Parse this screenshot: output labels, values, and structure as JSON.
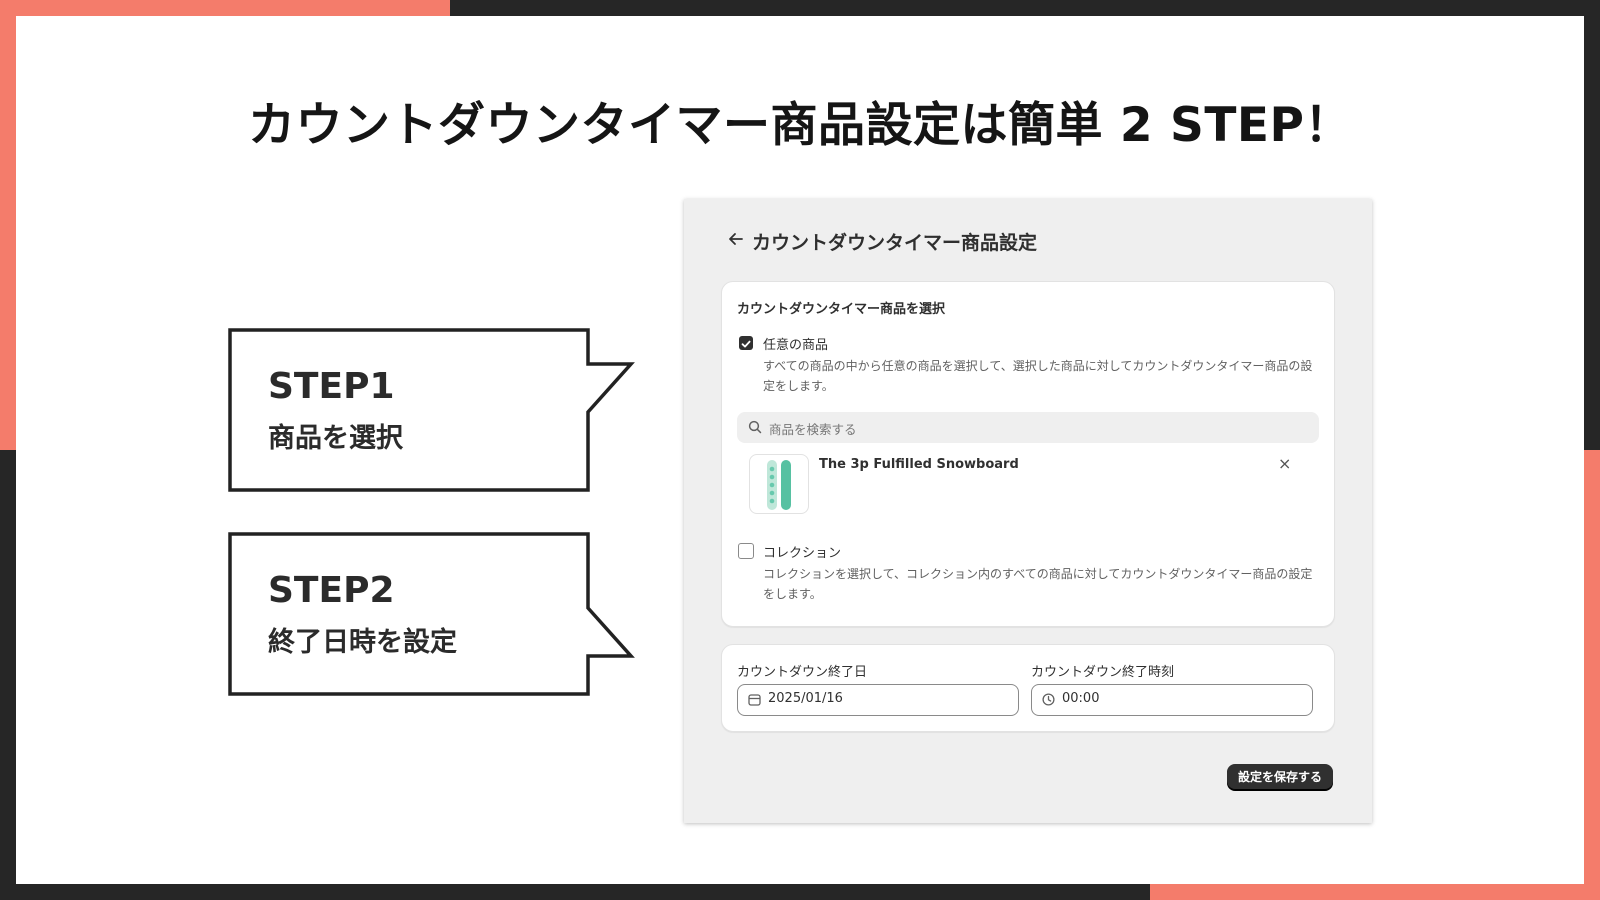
{
  "colors": {
    "accent": "#f47c6b",
    "dark": "#262626",
    "button": "#303030"
  },
  "headline": "カウントダウンタイマー商品設定は簡単 2 STEP！",
  "steps": [
    {
      "title": "STEP1",
      "subtitle": "商品を選択"
    },
    {
      "title": "STEP2",
      "subtitle": "終了日時を設定"
    }
  ],
  "panel": {
    "back_icon": "arrow-left-icon",
    "title": "カウントダウンタイマー商品設定",
    "product_card": {
      "title": "カウントダウンタイマー商品を選択",
      "option_products": {
        "label": "任意の商品",
        "checked": true,
        "help": "すべての商品の中から任意の商品を選択して、選択した商品に対してカウントダウンタイマー商品の設定をします。"
      },
      "search": {
        "icon": "search-icon",
        "placeholder": "商品を検索する"
      },
      "selected_product": {
        "name": "The 3p Fulfilled Snowboard",
        "remove_icon": "close-icon",
        "remove_symbol": "×"
      },
      "option_collection": {
        "label": "コレクション",
        "checked": false,
        "help": "コレクションを選択して、コレクション内のすべての商品に対してカウントダウンタイマー商品の設定をします。"
      }
    },
    "datetime_card": {
      "date_label": "カウントダウン終了日",
      "date_value": "2025/01/16",
      "date_icon": "calendar-icon",
      "time_label": "カウントダウン終了時刻",
      "time_value": "00:00",
      "time_icon": "clock-icon"
    },
    "save_button": "設定を保存する"
  }
}
